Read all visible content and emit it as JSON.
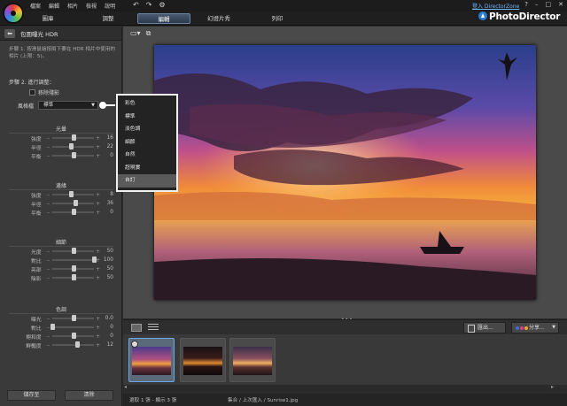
{
  "menu": [
    "檔案",
    "編輯",
    "相片",
    "檢視",
    "說明"
  ],
  "login_text": "登入 DirectorZone",
  "window_buttons": [
    "?",
    "–",
    "□",
    "✕"
  ],
  "mode_tabs": [
    {
      "label": "圖庫",
      "active": false
    },
    {
      "label": "調整",
      "active": false
    },
    {
      "label": "編輯",
      "active": true
    },
    {
      "label": "幻燈片秀",
      "active": false
    },
    {
      "label": "列印",
      "active": false
    }
  ],
  "brand": "PhotoDirector",
  "panel": {
    "title": "包圍曝光 HDR",
    "step1": "步驟 1. 按滑鼠繪按兩下要在 HDR 相片中使用的相片 (上限：5)。",
    "step2": "步驟 2. 進行調整：",
    "remove_ghost": "移除殘影",
    "style_label": "風格檔",
    "style_value": "標準"
  },
  "sections": [
    {
      "title": "光暈",
      "rows": [
        {
          "label": "強度",
          "value": "16",
          "pos": 0.5
        },
        {
          "label": "半徑",
          "value": "22",
          "pos": 0.45
        },
        {
          "label": "平衡",
          "value": "0",
          "pos": 0.5
        }
      ]
    },
    {
      "title": "邊緣",
      "rows": [
        {
          "label": "強度",
          "value": "8",
          "pos": 0.45
        },
        {
          "label": "半徑",
          "value": "36",
          "pos": 0.55
        },
        {
          "label": "平衡",
          "value": "0",
          "pos": 0.5
        }
      ]
    },
    {
      "title": "細節",
      "rows": [
        {
          "label": "光度",
          "value": "50",
          "pos": 0.5
        },
        {
          "label": "對比",
          "value": "100",
          "pos": 1.0
        },
        {
          "label": "亮部",
          "value": "50",
          "pos": 0.5
        },
        {
          "label": "陰影",
          "value": "50",
          "pos": 0.5
        }
      ]
    },
    {
      "title": "色調",
      "rows": [
        {
          "label": "曝光",
          "value": "0.0",
          "pos": 0.5
        },
        {
          "label": "對比",
          "value": "0",
          "pos": 0.0
        },
        {
          "label": "飽和度",
          "value": "0",
          "pos": 0.5
        },
        {
          "label": "鮮豔度",
          "value": "12",
          "pos": 0.6
        }
      ]
    }
  ],
  "buttons": {
    "save": "儲存至",
    "delete": "清除"
  },
  "dropdown": {
    "items": [
      "彩色",
      "標準",
      "淡色調",
      "細節",
      "自然",
      "超現實",
      "自訂"
    ],
    "selected_index": 6
  },
  "toolbar": {
    "export": "匯出...",
    "share": "分享..."
  },
  "share_colors": [
    "#3b6ed8",
    "#e23b8c",
    "#f5a623"
  ],
  "thumbnails": [
    {
      "selected": true,
      "variant": "a"
    },
    {
      "selected": false,
      "variant": "b"
    },
    {
      "selected": false,
      "variant": "c"
    }
  ],
  "status": {
    "left": "選取 1 張 - 顯示 3 張",
    "mid": "集合 / 上次匯入 / Sunrise1.jpg"
  }
}
